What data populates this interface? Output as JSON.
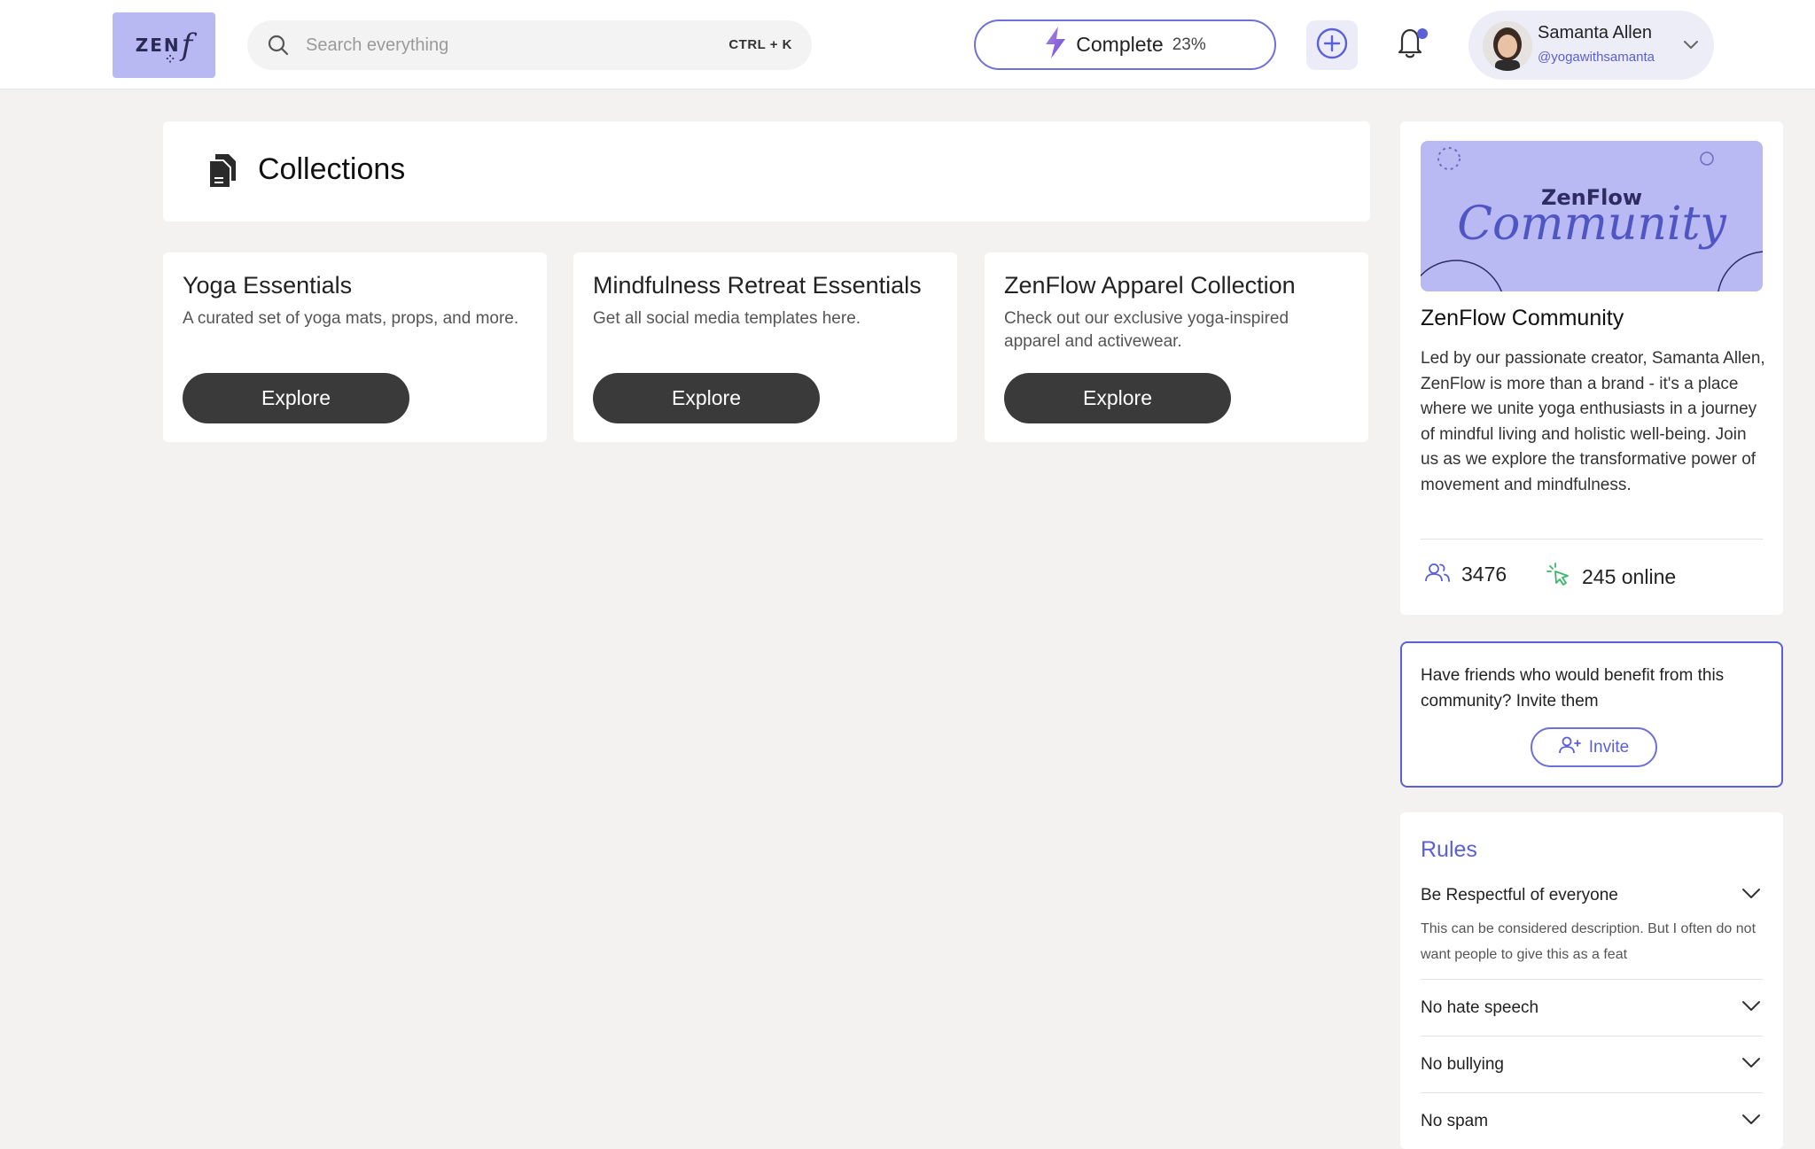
{
  "app": {
    "logo_text": "ZEN",
    "logo_f": "f"
  },
  "search": {
    "placeholder": "Search everything",
    "shortcut": "CTRL + K"
  },
  "progress": {
    "label": "Complete",
    "percent_text": "23%",
    "percent": 23
  },
  "user": {
    "name": "Samanta Allen",
    "handle": "@yogawithsamanta"
  },
  "collections": {
    "title": "Collections",
    "items": [
      {
        "title": "Yoga Essentials",
        "description": "A curated set of yoga mats, props, and more.",
        "button": "Explore"
      },
      {
        "title": "Mindfulness Retreat Essentials",
        "description": "Get all social media templates here.",
        "button": "Explore"
      },
      {
        "title": "ZenFlow Apparel Collection",
        "description": "Check out our exclusive yoga-inspired apparel and activewear.",
        "button": "Explore"
      }
    ]
  },
  "community": {
    "banner_title": "ZenFlow",
    "banner_script": "Community",
    "title": "ZenFlow Community",
    "description": "Led by our passionate creator, Samanta Allen, ZenFlow is more than a brand - it's a place where we unite yoga enthusiasts in a journey of mindful living and holistic well-being. Join us as we explore the transformative power of movement and mindfulness.",
    "members": "3476",
    "online": "245 online"
  },
  "invite": {
    "text": "Have friends who would benefit from this community? Invite them",
    "button": "Invite"
  },
  "rules": {
    "title": "Rules",
    "items": [
      {
        "title": "Be Respectful of everyone",
        "description": "This can be considered description. But I often do not want people to give this as a feat"
      },
      {
        "title": "No hate speech"
      },
      {
        "title": "No bullying"
      },
      {
        "title": "No spam"
      }
    ]
  },
  "colors": {
    "accent": "#5b5fd8",
    "logo_bg": "#b8b8f3",
    "button_dark": "#3a3a3a",
    "online_green": "#3bb56b"
  }
}
